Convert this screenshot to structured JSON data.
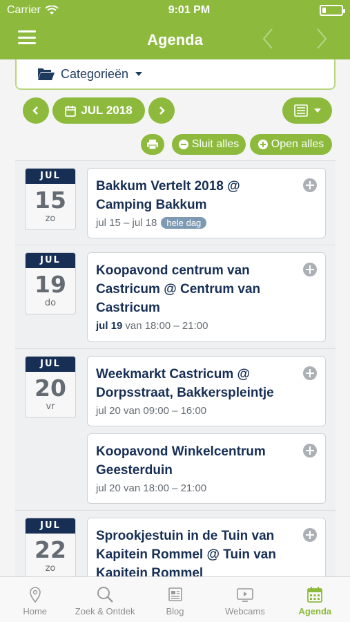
{
  "status": {
    "carrier": "Carrier",
    "time": "9:01 PM"
  },
  "nav": {
    "title": "Agenda"
  },
  "categories": {
    "label": "Categorieën"
  },
  "controls": {
    "month": "JUL 2018",
    "close_all": "Sluit alles",
    "open_all": "Open alles"
  },
  "days": [
    {
      "month": "JUL",
      "day": "15",
      "weekday": "zo",
      "events": [
        {
          "title": "Bakkum Vertelt 2018 @ Camping Bakkum",
          "date": "jul 15 – jul 18",
          "badge": "hele dag"
        }
      ]
    },
    {
      "month": "JUL",
      "day": "19",
      "weekday": "do",
      "events": [
        {
          "title": "Koopavond centrum van Castricum @ Centrum van Castricum",
          "date": "jul 19",
          "time": "van 18:00 – 21:00"
        }
      ]
    },
    {
      "month": "JUL",
      "day": "20",
      "weekday": "vr",
      "events": [
        {
          "title": "Weekmarkt Castricum @ Dorpsstraat, Bakkerspleintje",
          "time": "jul 20 van 09:00 – 16:00"
        },
        {
          "title": "Koopavond Winkelcentrum Geesterduin",
          "time": "jul 20 van 18:00 – 21:00"
        }
      ]
    },
    {
      "month": "JUL",
      "day": "22",
      "weekday": "zo",
      "events": [
        {
          "title": "Sprookjestuin in de Tuin van Kapitein Rommel @ Tuin van Kapitein Rommel"
        }
      ]
    }
  ],
  "tabs": [
    {
      "label": "Home",
      "icon": "location-pin-icon"
    },
    {
      "label": "Zoek & Ontdek",
      "icon": "search-icon"
    },
    {
      "label": "Blog",
      "icon": "newspaper-icon"
    },
    {
      "label": "Webcams",
      "icon": "tv-play-icon"
    },
    {
      "label": "Agenda",
      "icon": "calendar-icon",
      "active": true
    }
  ],
  "colors": {
    "accent": "#8dba3d",
    "navy": "#172f55",
    "badge": "#7e9ab3"
  }
}
